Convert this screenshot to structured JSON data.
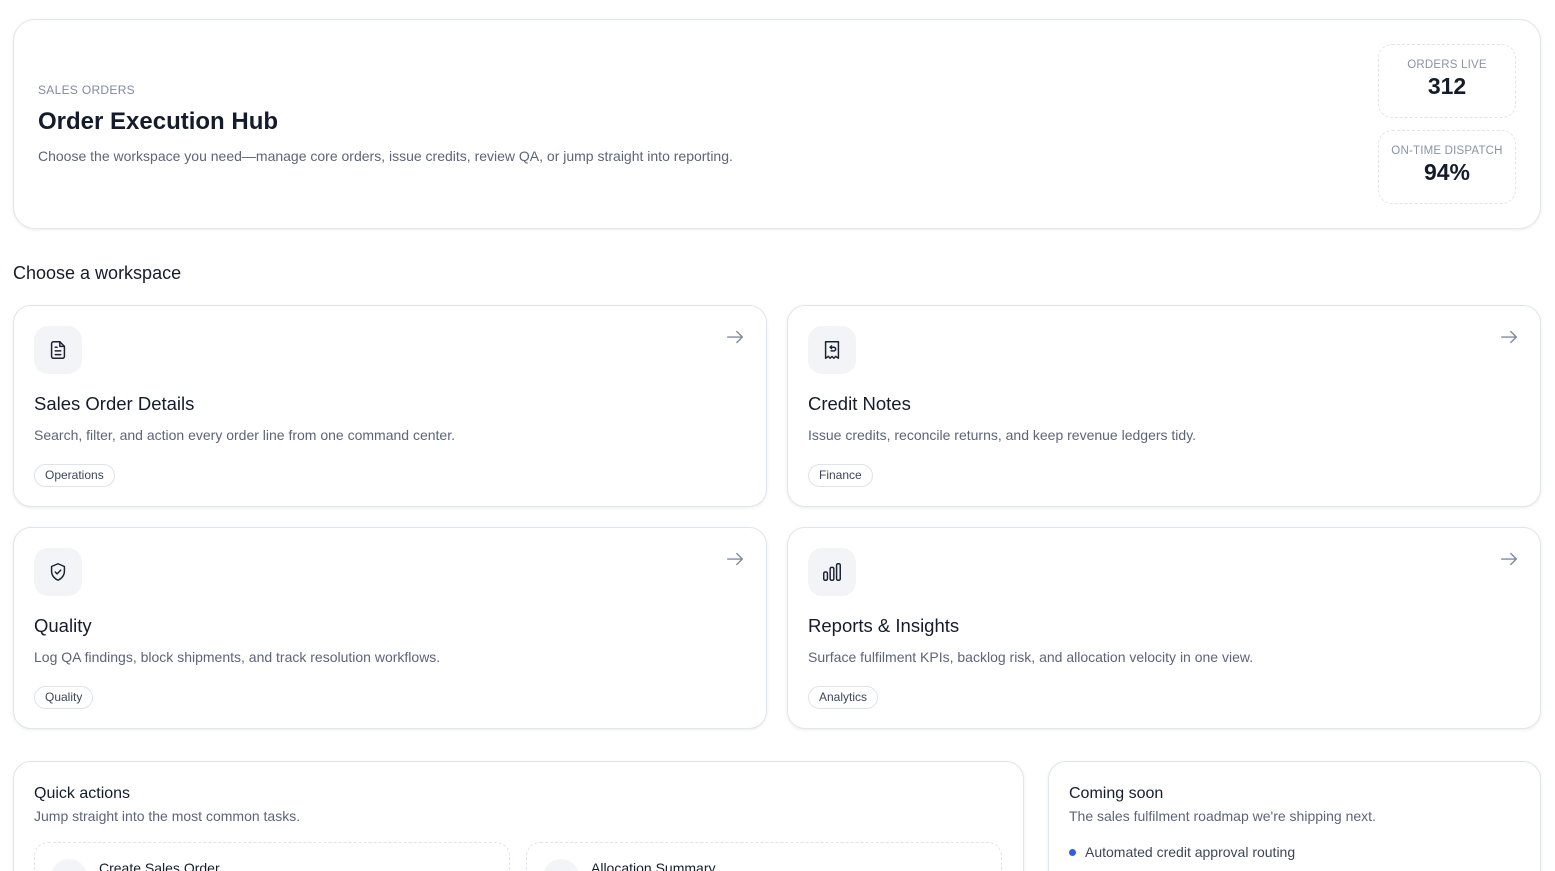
{
  "hero": {
    "eyebrow": "SALES ORDERS",
    "title": "Order Execution Hub",
    "subtitle": "Choose the workspace you need—manage core orders, issue credits, review QA, or jump straight into reporting.",
    "stats": [
      {
        "label": "ORDERS LIVE",
        "value": "312"
      },
      {
        "label": "ON-TIME DISPATCH",
        "value": "94%"
      }
    ]
  },
  "workspaces": {
    "heading": "Choose a workspace",
    "items": [
      {
        "title": "Sales Order Details",
        "description": "Search, filter, and action every order line from one command center.",
        "tag": "Operations",
        "icon": "document-icon"
      },
      {
        "title": "Credit Notes",
        "description": "Issue credits, reconcile returns, and keep revenue ledgers tidy.",
        "tag": "Finance",
        "icon": "receipt-refund-icon"
      },
      {
        "title": "Quality",
        "description": "Log QA findings, block shipments, and track resolution workflows.",
        "tag": "Quality",
        "icon": "shield-check-icon"
      },
      {
        "title": "Reports & Insights",
        "description": "Surface fulfilment KPIs, backlog risk, and allocation velocity in one view.",
        "tag": "Analytics",
        "icon": "bar-chart-icon"
      }
    ]
  },
  "quick_actions": {
    "title": "Quick actions",
    "subtitle": "Jump straight into the most common tasks.",
    "items": [
      {
        "label": "Create Sales Order",
        "icon": "plus-icon"
      },
      {
        "label": "Allocation Summary",
        "icon": "layers-icon"
      }
    ]
  },
  "coming_soon": {
    "title": "Coming soon",
    "subtitle": "The sales fulfilment roadmap we're shipping next.",
    "items": [
      "Automated credit approval routing"
    ],
    "bullet_color": "#2f5fe0"
  }
}
